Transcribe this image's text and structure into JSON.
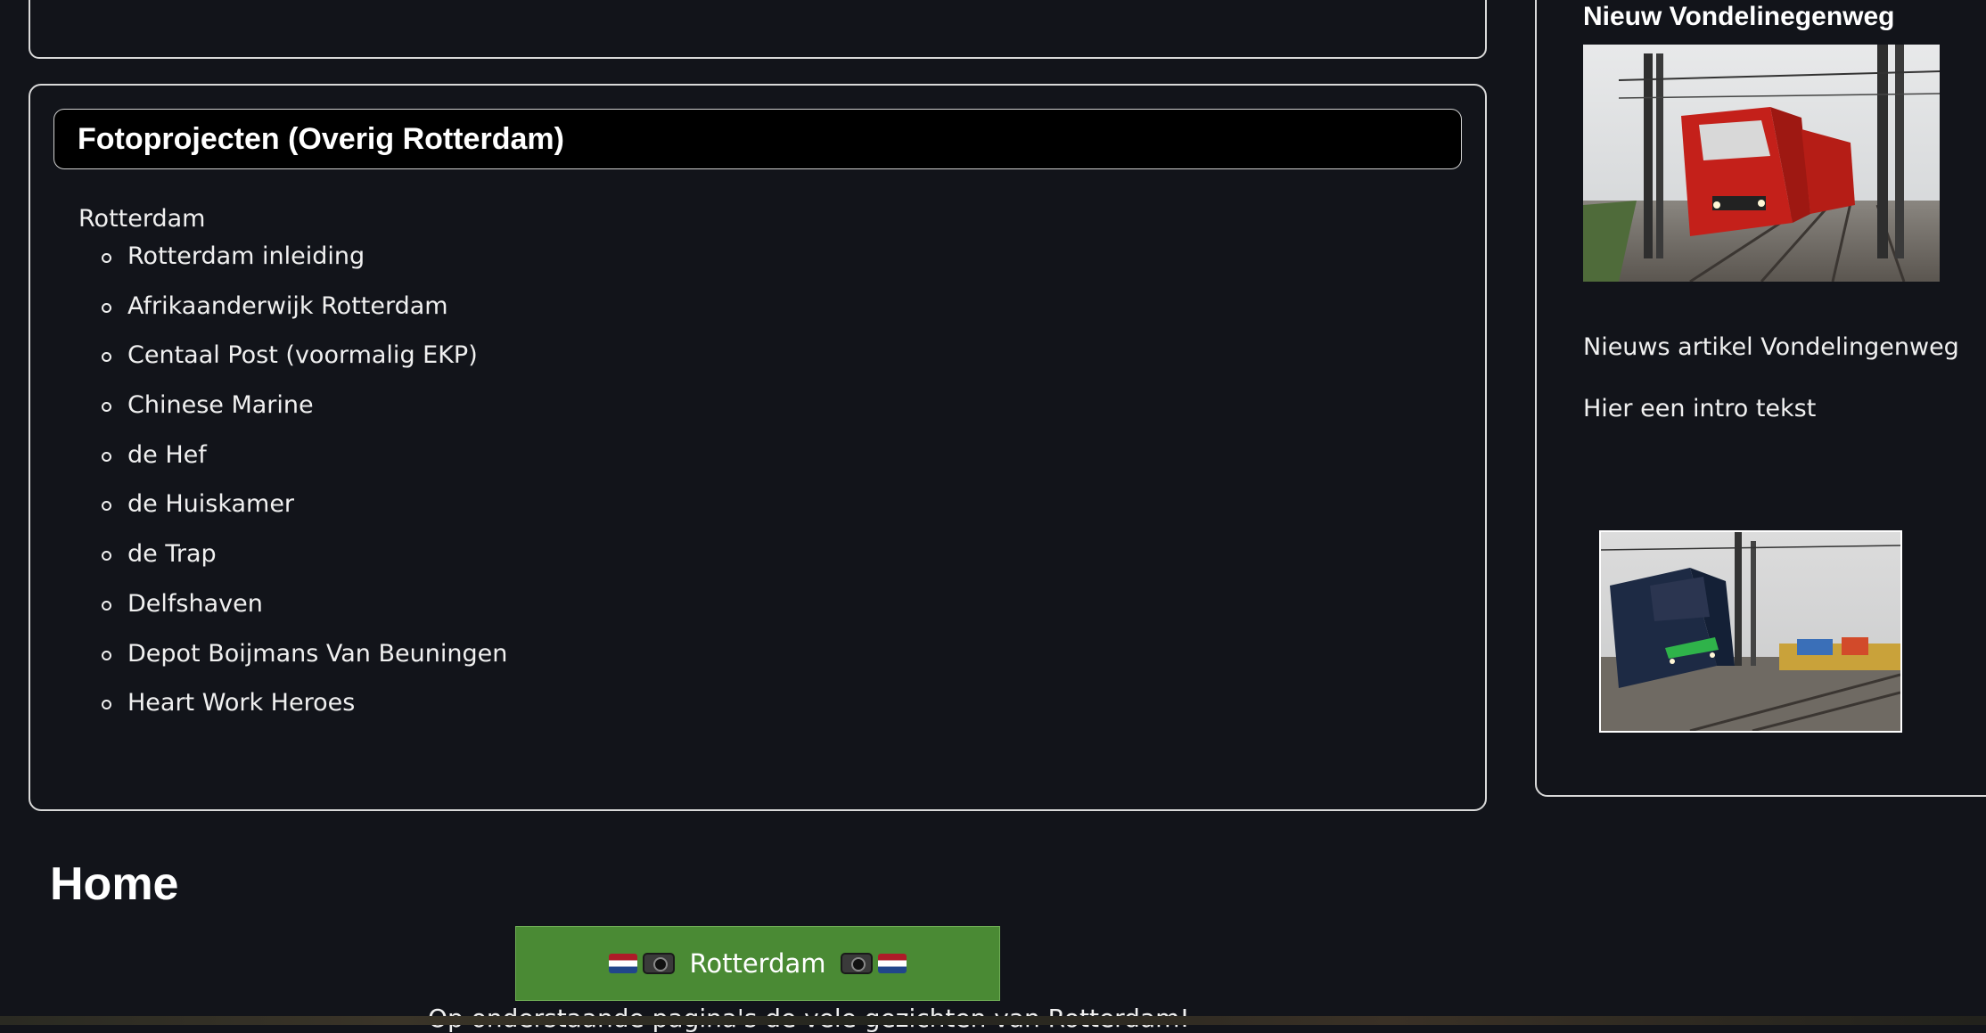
{
  "projects": {
    "title": "Fotoprojecten (Overig Rotterdam)",
    "parent": "Rotterdam",
    "items": [
      "Rotterdam inleiding",
      "Afrikaanderwijk Rotterdam",
      "Centaal Post (voormalig EKP)",
      "Chinese Marine",
      "de Hef",
      "de Huiskamer",
      "de Trap",
      "Delfshaven",
      "Depot Boijmans Van Beuningen",
      "Heart Work Heroes"
    ]
  },
  "main": {
    "heading": "Home",
    "button_label": "Rotterdam",
    "intro": "Op onderstaande pagina's de vele gezichten van Rotterdam!"
  },
  "sidebar": {
    "title": "Nieuw Vondelinegenweg",
    "article_title": "Nieuws artikel Vondelingenweg",
    "intro": "Hier een intro tekst"
  },
  "colors": {
    "background": "#12141a",
    "button_green": "#4a8a34",
    "header_black": "#000000"
  },
  "icons": [
    "netherlands-flag-icon",
    "camera-icon"
  ]
}
